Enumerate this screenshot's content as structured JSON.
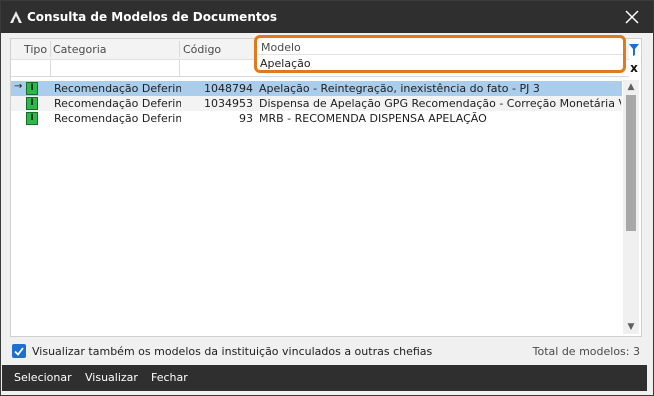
{
  "window": {
    "title": "Consulta de Modelos de Documentos"
  },
  "columns": {
    "tipo": "Tipo",
    "categoria": "Categoria",
    "codigo": "Código",
    "modelo": "Modelo"
  },
  "filter": {
    "modelo_value": "Apelação",
    "clear_glyph": "x"
  },
  "rows": [
    {
      "marker": "→",
      "tipo_badge": "I",
      "categoria": "Recomendação Deferime",
      "codigo": "1048794",
      "modelo": "Apelação - Reintegração, inexistência do fato - PJ 3",
      "selected": true
    },
    {
      "marker": "",
      "tipo_badge": "I",
      "categoria": "Recomendação Deferime",
      "codigo": "1034953",
      "modelo": "Dispensa de Apelação GPG Recomendação - Correção Monetária Venc…",
      "selected": false
    },
    {
      "marker": "",
      "tipo_badge": "I",
      "categoria": "Recomendação Deferime",
      "codigo": "93",
      "modelo": "MRB - RECOMENDA DISPENSA APELAÇÃO",
      "selected": false
    }
  ],
  "options": {
    "show_other_models_label": "Visualizar também os modelos da instituição vinculados a outras chefias",
    "show_other_models_checked": true
  },
  "footer": {
    "total_label": "Total de modelos: 3"
  },
  "actions": {
    "select": "Selecionar",
    "view": "Visualizar",
    "close": "Fechar"
  },
  "colors": {
    "titlebar_bg": "#2f2f2f",
    "highlight_border": "#e07a1c",
    "selected_row": "#a9cdeb",
    "tipo_badge": "#2db84b",
    "checkbox": "#1e6fd0"
  },
  "icons": {
    "app": "app-logo-icon",
    "close": "close-icon",
    "filter": "filter-icon",
    "check": "checkmark-icon",
    "scroll_up": "chevron-up-icon",
    "scroll_down": "chevron-down-icon"
  }
}
